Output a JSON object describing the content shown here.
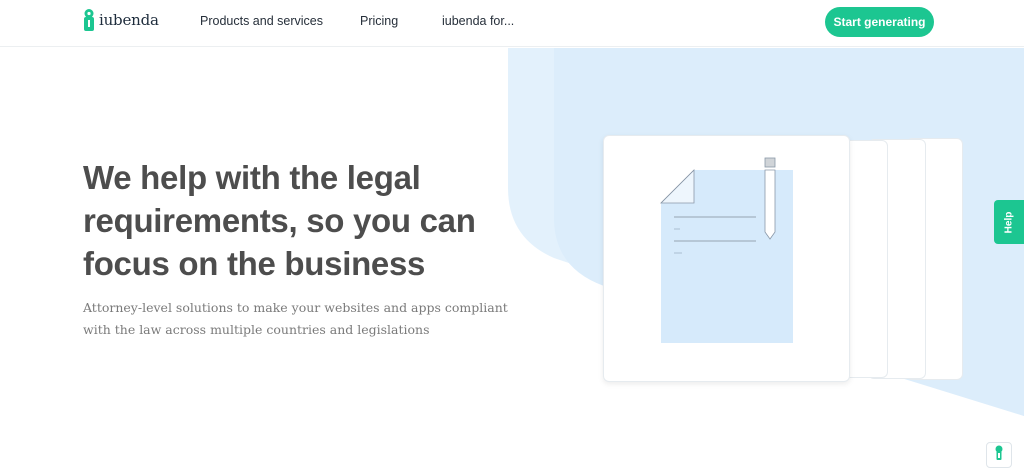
{
  "header": {
    "brand": "iubenda",
    "nav": [
      {
        "label": "Products and services"
      },
      {
        "label": "Pricing"
      },
      {
        "label": "iubenda for..."
      }
    ],
    "cta_label": "Start generating"
  },
  "hero": {
    "title": "We help with the legal requirements, so you can focus on the business",
    "subtitle": "Attorney-level solutions to make your websites and apps compliant with the law across multiple countries and legislations"
  },
  "help_label": "Help",
  "icons": {
    "logo": "iubenda-logo-icon",
    "document": "document-illustration",
    "pen": "pen-illustration",
    "lock": "keyhole-icon"
  },
  "colors": {
    "brand_green": "#1cc691",
    "hero_bg_blue": "#e3f1fc",
    "doc_blue": "#d6eafb",
    "title_text": "#4d4d4d"
  }
}
